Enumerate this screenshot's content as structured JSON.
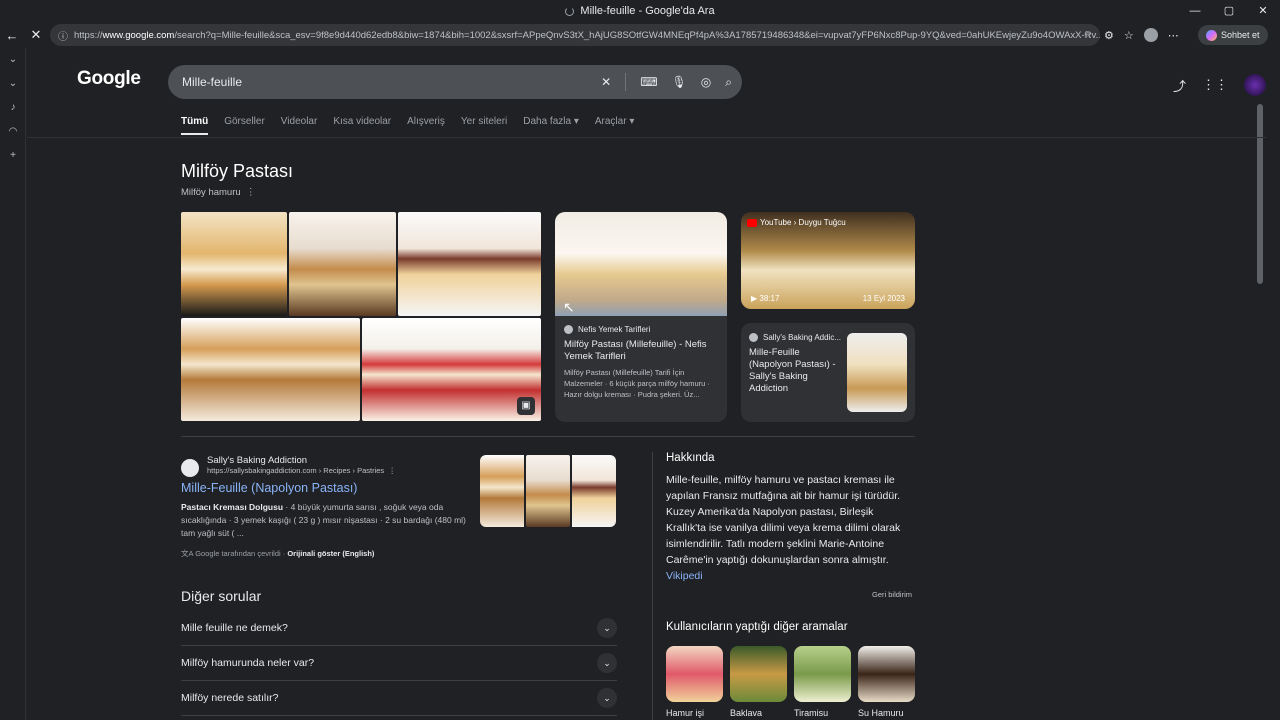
{
  "window": {
    "title": "Mille-feuille - Google'da Ara",
    "controls": [
      "—",
      "▢",
      "✕"
    ]
  },
  "browser": {
    "url_prefix": "https://",
    "url_host": "www.google.com",
    "url_rest": "/search?q=Mille-feuille&sca_esv=9f8e9d440d62edb8&biw=1874&bih=1002&sxsrf=APpeQnvS3tX_hAjUG8SOtfGW4MNEqPf4pA%3A1785719486348&ei=vupvat7yFP6Nxc8Pup-9YQ&ved=0ahUKEwjeyZu9o4OWAxX-Rv...",
    "copilot_label": "Sohbet et"
  },
  "search": {
    "query": "Mille-feuille"
  },
  "logo": "Google",
  "tabs": [
    "Tümü",
    "Görseller",
    "Videolar",
    "Kısa videolar",
    "Alışveriş",
    "Yer siteleri",
    "Daha fazla",
    "Araçlar"
  ],
  "knowledge": {
    "title": "Milföy Pastası",
    "subtitle": "Milföy hamuru"
  },
  "cards": {
    "nefis": {
      "source": "Nefis Yemek Tarifleri",
      "title": "Milföy Pastası (Millefeuille) - Nefis Yemek Tarifleri",
      "desc": "Milföy Pastası (Millefeuille) Tarifi İçin Malzemeler · 6 küçük parça milföy hamuru · Hazır dolgu kreması · Pudra şekeri. Üz..."
    },
    "youtube": {
      "badge": "YouTube › Duygu Tuğcu",
      "duration": "38:17",
      "date": "13 Eyl 2023"
    },
    "sally_small": {
      "source": "Sally's Baking Addic...",
      "title": "Mille-Feuille (Napolyon Pastası) - Sally's Baking Addiction"
    }
  },
  "result": {
    "site": "Sally's Baking Addiction",
    "cite": "https://sallysbakingaddiction.com › Recipes › Pastries",
    "title": "Mille-Feuille (Napolyon Pastası)",
    "snippet_bold": "Pastacı Kreması Dolgusu",
    "snippet_rest": " · 4 büyük yumurta sarısı , soğuk veya oda sıcaklığında · 3 yemek kaşığı ( 23 g ) mısır nişastası · 2 su bardağı (480 ml) tam yağlı süt ( ...",
    "translated": "Google tarafından çevrildi · ",
    "original": "Orijinali göster (English)"
  },
  "about": {
    "heading": "Hakkında",
    "text": "Mille-feuille, milföy hamuru ve pastacı kreması ile yapılan Fransız mutfağına ait bir hamur işi türüdür. Kuzey Amerika'da Napolyon pastası, Birleşik Krallık'ta ise vanilya dilimi veya krema dilimi olarak isimlendirilir. Tatlı modern şeklini Marie-Antoine Carême'in yaptığı dokunuşlardan sonra almıştır.",
    "wiki": "Vikipedi",
    "feedback": "Geri bildirim"
  },
  "related": {
    "title": "Kullanıcıların yaptığı diğer aramalar",
    "items": [
      "Hamur işi",
      "Baklava",
      "Tiramisu",
      "Su Hamuru"
    ]
  },
  "paa": {
    "title": "Diğer sorular",
    "items": [
      "Mille feuille ne demek?",
      "Milföy hamurunda neler var?",
      "Milföy nerede satılır?"
    ]
  }
}
